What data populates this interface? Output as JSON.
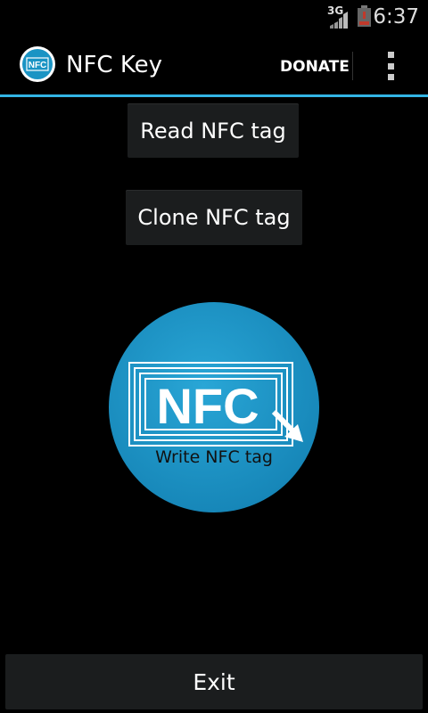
{
  "status_bar": {
    "network": "3G",
    "time": "6:37"
  },
  "action_bar": {
    "title": "NFC Key",
    "donate_label": "DONATE",
    "app_icon_text": "NFC"
  },
  "buttons": {
    "read_label": "Read NFC tag",
    "clone_label": "Clone NFC tag",
    "write_label": "Write NFC tag",
    "write_logo_text": "NFC",
    "exit_label": "Exit"
  },
  "colors": {
    "accent": "#33b5e5",
    "write_circle": "#1a94c4",
    "button_bg": "#1b1d1e"
  }
}
